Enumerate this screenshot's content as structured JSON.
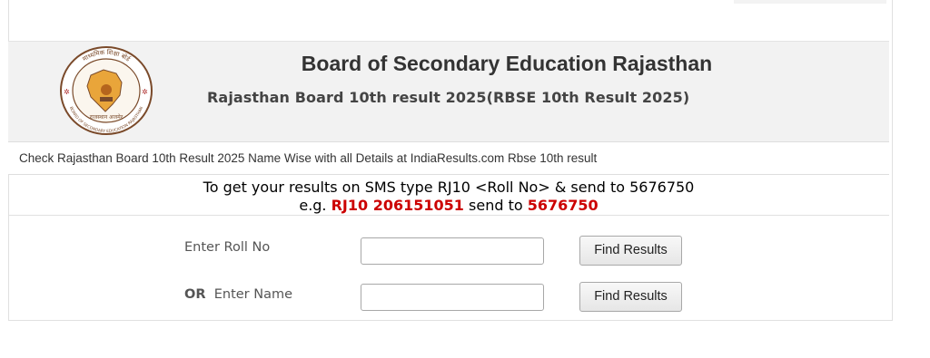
{
  "header": {
    "title": "Board of Secondary Education Rajasthan",
    "subtitle": "Rajasthan Board 10th result 2025(RBSE 10th Result 2025)"
  },
  "logo": {
    "ring_text": "BOARD OF SECONDARY EDUCATION RAJASTHAN",
    "top_text": "माध्यमिक शिक्षा बोर्ड",
    "bottom_text": "राजस्थान अजमेर",
    "color": "#7a4a2a"
  },
  "info": {
    "text": "Check Rajasthan Board 10th Result 2025 Name Wise with all Details at IndiaResults.com Rbse 10th result"
  },
  "sms": {
    "line1": "To get your results on SMS type RJ10 <Roll No> & send to 5676750",
    "eg_prefix": "e.g. ",
    "eg_code": "RJ10 206151051",
    "eg_mid": " send to ",
    "eg_number": "5676750"
  },
  "form": {
    "roll_label": "Enter Roll No",
    "roll_value": "",
    "or_label": "OR",
    "name_label": "Enter Name",
    "name_value": "",
    "roll_button": "Find Results",
    "name_button": "Find Results"
  },
  "colors": {
    "accent_red": "#cc0000",
    "header_bg": "#f2f2f2"
  }
}
